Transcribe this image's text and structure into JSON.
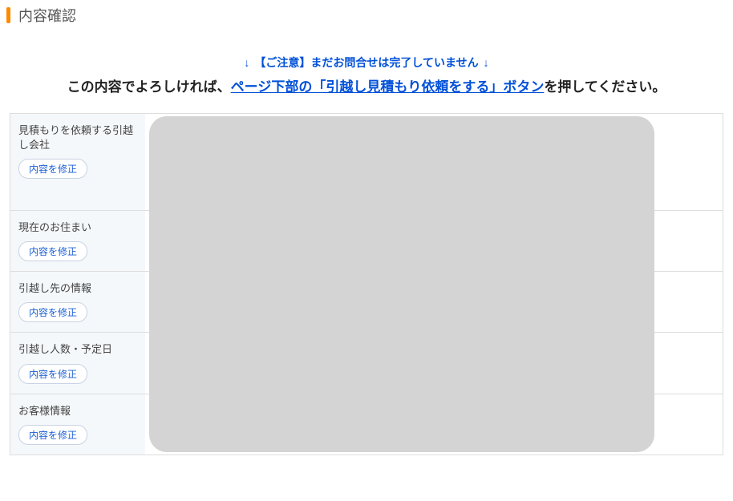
{
  "page_title": "内容確認",
  "notice_text": "【ご注意】まだお問合せは完了していません",
  "instruction_prefix": "この内容でよろしければ、",
  "instruction_link": "ページ下部の「引越し見積もり依頼をする」ボタン",
  "instruction_suffix": "を押してください。",
  "edit_button_label": "内容を修正",
  "rows": [
    {
      "label": "見積もりを依頼する引越し会社"
    },
    {
      "label": "現在のお住まい"
    },
    {
      "label": "引越し先の情報"
    },
    {
      "label": "引越し人数・予定日"
    },
    {
      "label": "お客様情報"
    }
  ]
}
